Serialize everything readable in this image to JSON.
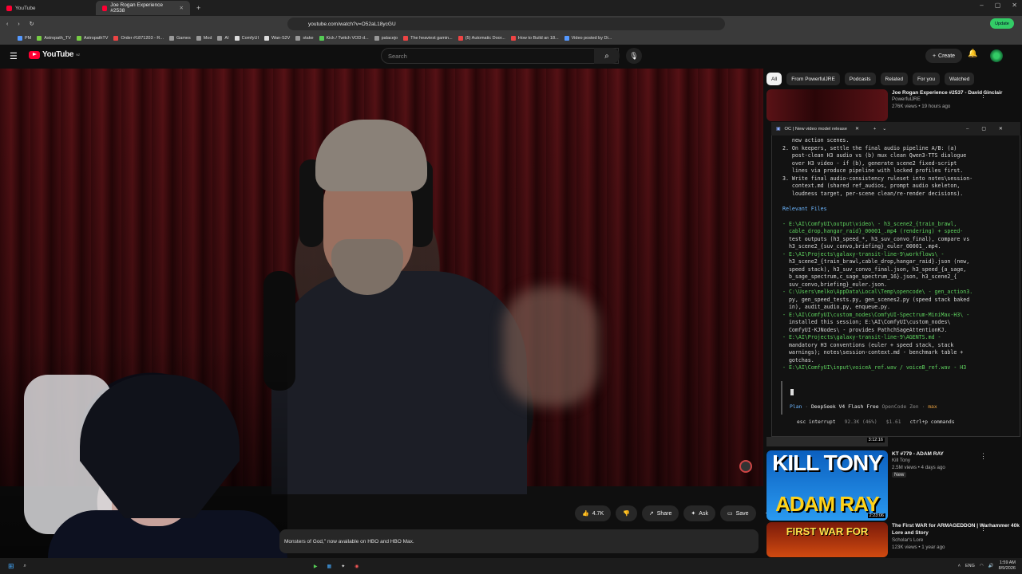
{
  "browser": {
    "tabs": [
      {
        "label": "YouTube",
        "active": false
      },
      {
        "label": "Joe Rogan Experience #2538",
        "active": true
      }
    ],
    "url": "youtube.com/watch?v=O52aL18ycGU",
    "update_label": "Update",
    "bookmarks": [
      "PM",
      "Astropath_TV",
      "AstropathTV",
      "Order #1871203 - R...",
      "Games",
      "Mod",
      "AI",
      "ComfyUI",
      "Wan-S2V",
      "stake",
      "Kick / Twitch VOD d...",
      "palacejo",
      "The heaviest gamin...",
      "(5) Automatic Door...",
      "How to Build an 18...",
      "Video posted by Di..."
    ]
  },
  "youtube": {
    "logo": "YouTube",
    "logo_region": "NZ",
    "search_placeholder": "Search",
    "create_label": "Create",
    "chips": [
      "All",
      "From PowerfulJRE",
      "Podcasts",
      "Related",
      "For you",
      "Watched"
    ],
    "actions": {
      "like_count": "4.7K",
      "share": "Share",
      "ask": "Ask",
      "save": "Save"
    },
    "description_snippet": "Monsters of God,\" now available on HBO and HBO Max.",
    "side_videos": [
      {
        "title": "Joe Rogan Experience #2537 - David Sinclair",
        "channel": "PowerfulJRE",
        "meta": "276K views • 19 hours ago"
      },
      {
        "title": "KT #779 - ADAM RAY",
        "channel": "Kill Tony",
        "meta": "2.5M views • 4 days ago",
        "badge": "New",
        "duration": "2:23:06",
        "thumb_line1": "KILL TONY",
        "thumb_line2": "ADAM RAY"
      },
      {
        "title": "The First WAR for ARMAGEDDON | Warhammer 40k Lore and Story",
        "channel": "Scholar's Lore",
        "meta": "123K views • 1 year ago",
        "thumb_text": "FIRST WAR FOR"
      }
    ],
    "partial_duration": "3:12:16"
  },
  "terminal": {
    "title": "OC | New video model release",
    "lines": [
      {
        "t": "   new action scenes.",
        "c": ""
      },
      {
        "t": "2. On keepers, settle the final audio pipeline A/B: (a)",
        "c": ""
      },
      {
        "t": "   post-clean H3 audio vs (b) mux clean Qwen3-TTS dialogue",
        "c": ""
      },
      {
        "t": "   over H3 video - if (b), generate scene2 fixed-script",
        "c": ""
      },
      {
        "t": "   lines via produce pipeline with locked profiles first.",
        "c": ""
      },
      {
        "t": "3. Write final audio-consistency ruleset into notes\\session-",
        "c": ""
      },
      {
        "t": "   context.md (shared ref_audios, prompt audio skeleton,",
        "c": ""
      },
      {
        "t": "   loudness target, per-scene clean/re-render decisions).",
        "c": ""
      },
      {
        "t": "",
        "c": ""
      },
      {
        "t": "Relevant Files",
        "c": "hd"
      },
      {
        "t": "",
        "c": ""
      },
      {
        "t": "- E:\\AI\\ComfyUI\\output\\video\\ - h3_scene2_{train_brawl,",
        "c": "g"
      },
      {
        "t": "  cable_drop,hangar_raid}_00001_.mp4 (rendering) + speed-",
        "c": "g"
      },
      {
        "t": "  test outputs (h3_speed_*, h3_suv_convo_final), compare vs",
        "c": ""
      },
      {
        "t": "  h3_scene2_{suv_convo,briefing}_euler_00001_.mp4.",
        "c": ""
      },
      {
        "t": "- E:\\AI\\Projects\\galaxy-transit-line-9\\workflows\\ -",
        "c": "g"
      },
      {
        "t": "  h3_scene2_{train_brawl,cable_drop,hangar_raid}.json (new,",
        "c": ""
      },
      {
        "t": "  speed stack), h3_suv_convo_final.json, h3_speed_{a_sage,",
        "c": ""
      },
      {
        "t": "  b_sage_spectrum,c_sage_spectrum_16}.json, h3_scene2_{",
        "c": ""
      },
      {
        "t": "  suv_convo,briefing}_euler.json.",
        "c": ""
      },
      {
        "t": "- C:\\Users\\melko\\AppData\\Local\\Temp\\opencode\\ - gen_action3.",
        "c": "g"
      },
      {
        "t": "  py, gen_speed_tests.py, gen_scenes2.py (speed stack baked",
        "c": ""
      },
      {
        "t": "  in), audit_audio.py, enqueue.py.",
        "c": ""
      },
      {
        "t": "- E:\\AI\\ComfyUI\\custom_nodes\\ComfyUI-Spectrum-MiniMax-H3\\ -",
        "c": "g"
      },
      {
        "t": "  installed this session; E:\\AI\\ComfyUI\\custom_nodes\\",
        "c": ""
      },
      {
        "t": "  ComfyUI-KJNodes\\ - provides PathchSageAttentionKJ.",
        "c": ""
      },
      {
        "t": "- E:\\AI\\Projects\\galaxy-transit-line-9\\AGENTS.md -",
        "c": "g"
      },
      {
        "t": "  mandatory H3 conventions (euler + speed stack, stack",
        "c": ""
      },
      {
        "t": "  warnings); notes\\session-context.md - benchmark table +",
        "c": ""
      },
      {
        "t": "  gotchas.",
        "c": ""
      },
      {
        "t": "- E:\\AI\\ComfyUI\\input\\voiceA_ref.wav / voiceB_ref.wav - H3",
        "c": "g"
      }
    ],
    "status": {
      "mode": "Plan",
      "model": "DeepSeek V4 Flash Free",
      "provider": "OpenCode Zen",
      "effort": "max"
    },
    "footer": {
      "interrupt": "esc interrupt",
      "tokens": "92.3K (46%)",
      "cost": "$1.61",
      "commands": "ctrl+p commands"
    }
  },
  "taskbar": {
    "lang": "ENG",
    "time": "1:59 AM",
    "date": "8/9/2026"
  }
}
